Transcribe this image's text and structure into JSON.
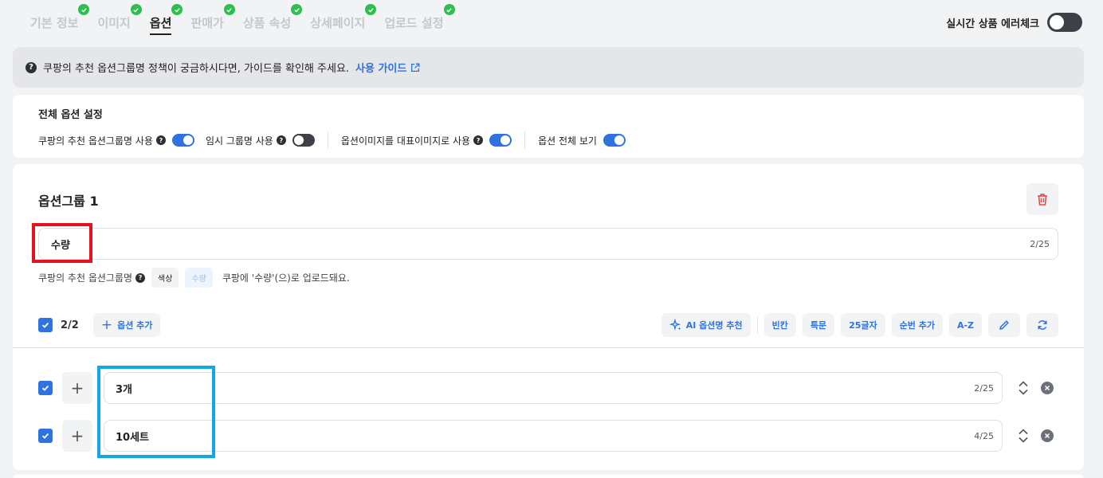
{
  "tabs": [
    {
      "label": "기본 정보",
      "done": true,
      "active": false
    },
    {
      "label": "이미지",
      "done": true,
      "active": false
    },
    {
      "label": "옵션",
      "done": true,
      "active": true
    },
    {
      "label": "판매가",
      "done": true,
      "active": false
    },
    {
      "label": "상품 속성",
      "done": true,
      "active": false
    },
    {
      "label": "상세페이지",
      "done": true,
      "active": false
    },
    {
      "label": "업로드 설정",
      "done": true,
      "active": false
    }
  ],
  "error_check": {
    "label": "실시간 상품 에러체크",
    "enabled": false
  },
  "guide": {
    "text": "쿠팡의 추천 옵션그룹명 정책이 궁금하시다면, 가이드를 확인해 주세요.",
    "link": "사용 가이드"
  },
  "settings": {
    "title": "전체 옵션 설정",
    "items": [
      {
        "label": "쿠팡의 추천 옵션그룹명 사용",
        "help": true,
        "on": true
      },
      {
        "label": "임시 그룹명 사용",
        "help": true,
        "on": false
      },
      {
        "label": "옵션이미지를 대표이미지로 사용",
        "help": true,
        "on": true
      },
      {
        "label": "옵션 전체 보기",
        "help": false,
        "on": true
      }
    ]
  },
  "group": {
    "title": "옵션그룹 1",
    "name_value": "수량",
    "name_counter": "2/25",
    "rec_label": "쿠팡의 추천 옵션그룹명",
    "rec_chips": [
      "색상",
      "수량"
    ],
    "rec_message": "쿠팡에 '수량'(으)로 업로드돼요.",
    "selected_count": "2/2",
    "add_option_label": "옵션 추가",
    "tools": {
      "ai": "AI 옵션명 추천",
      "blank": "빈칸",
      "special": "특문",
      "chars25": "25글자",
      "seq": "순번 추가",
      "az": "A-Z"
    },
    "options": [
      {
        "value": "3개",
        "counter": "2/25",
        "checked": true
      },
      {
        "value": "10세트",
        "counter": "4/25",
        "checked": true
      }
    ]
  },
  "colors": {
    "accent": "#2f73e0",
    "done": "#2fbe4f",
    "highlight_red": "#e3121f",
    "highlight_blue": "#10a8e8"
  }
}
